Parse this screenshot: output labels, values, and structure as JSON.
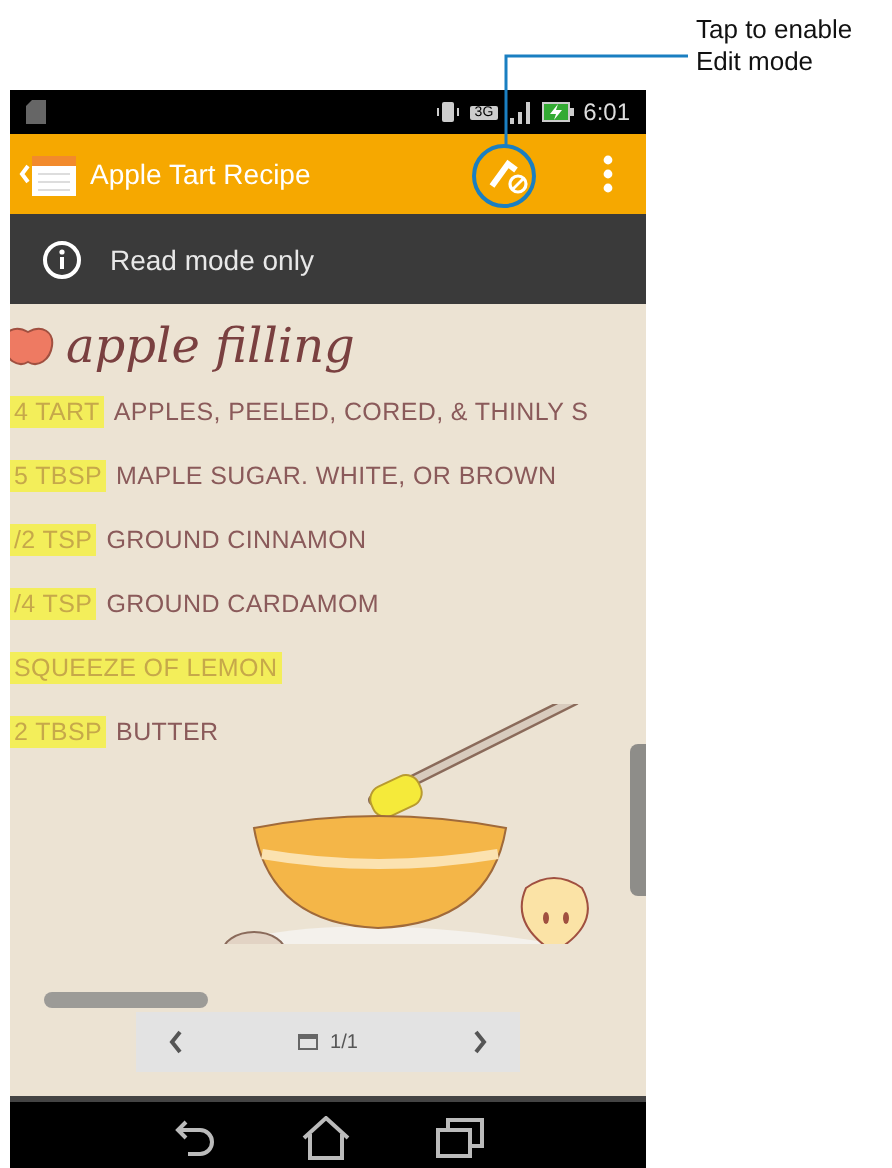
{
  "status_bar": {
    "time": "6:01",
    "network": "3G"
  },
  "app_bar": {
    "title": "Apple Tart Recipe"
  },
  "banner": {
    "text": "Read mode only"
  },
  "note": {
    "heading": "apple filling",
    "lines": [
      [
        {
          "text": "4 TART",
          "highlighted": true
        },
        {
          "text": "APPLES, PEELED, CORED, & THINLY S",
          "highlighted": false
        }
      ],
      [
        {
          "text": "5 TBSP",
          "highlighted": true
        },
        {
          "text": "MAPLE SUGAR. WHITE, OR BROWN",
          "highlighted": false
        }
      ],
      [
        {
          "text": "/2 TSP",
          "highlighted": true
        },
        {
          "text": "GROUND CINNAMON",
          "highlighted": false
        }
      ],
      [
        {
          "text": "/4 TSP",
          "highlighted": true
        },
        {
          "text": "GROUND CARDAMOM",
          "highlighted": false
        }
      ],
      [
        {
          "text": "SQUEEZE OF LEMON",
          "highlighted": true
        }
      ],
      [
        {
          "text": "2 TBSP",
          "highlighted": true
        },
        {
          "text": "BUTTER",
          "highlighted": false
        }
      ]
    ]
  },
  "pager": {
    "page": "1/1"
  },
  "callout": {
    "lines": [
      "Tap to enable",
      "Edit mode"
    ]
  }
}
